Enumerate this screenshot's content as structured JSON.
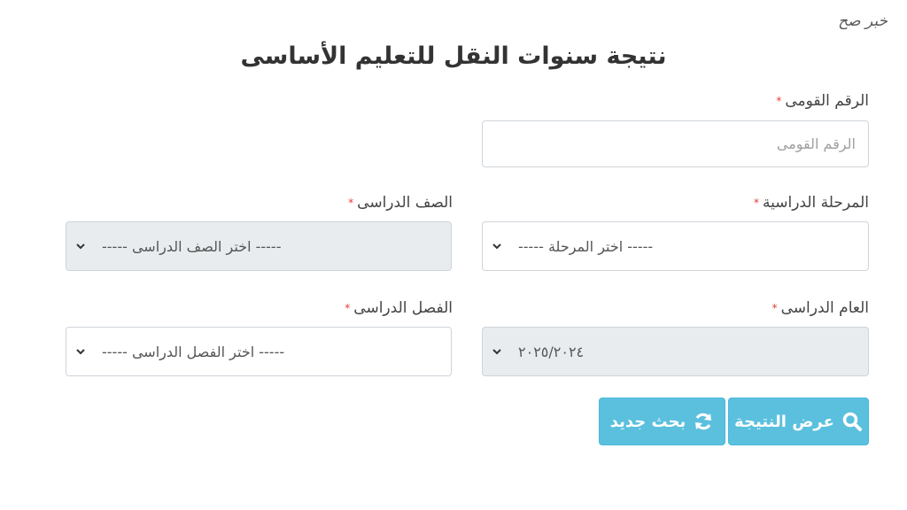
{
  "watermark": "خبر صح",
  "title": "نتيجة سنوات النقل للتعليم الأساسى",
  "required_mark": "*",
  "national_id": {
    "label": "الرقم القومى",
    "placeholder": "الرقم القومى"
  },
  "stage": {
    "label": "المرحلة الدراسية",
    "selected": "----- اختر المرحلة -----"
  },
  "grade": {
    "label": "الصف الدراسى",
    "selected": "----- اختر الصف الدراسى -----"
  },
  "year": {
    "label": "العام الدراسى",
    "selected": "٢٠٢٥/٢٠٢٤"
  },
  "term": {
    "label": "الفصل الدراسى",
    "selected": "----- اختر الفصل الدراسى -----"
  },
  "buttons": {
    "show_result": "عرض النتيجة",
    "new_search": "بحث جديد"
  },
  "colors": {
    "button": "#5bc0de",
    "required": "#e53935",
    "disabled_bg": "#e9ecef"
  },
  "icons": {
    "show_result": "search-icon",
    "new_search": "refresh-icon",
    "select": "chevron-down-icon"
  }
}
